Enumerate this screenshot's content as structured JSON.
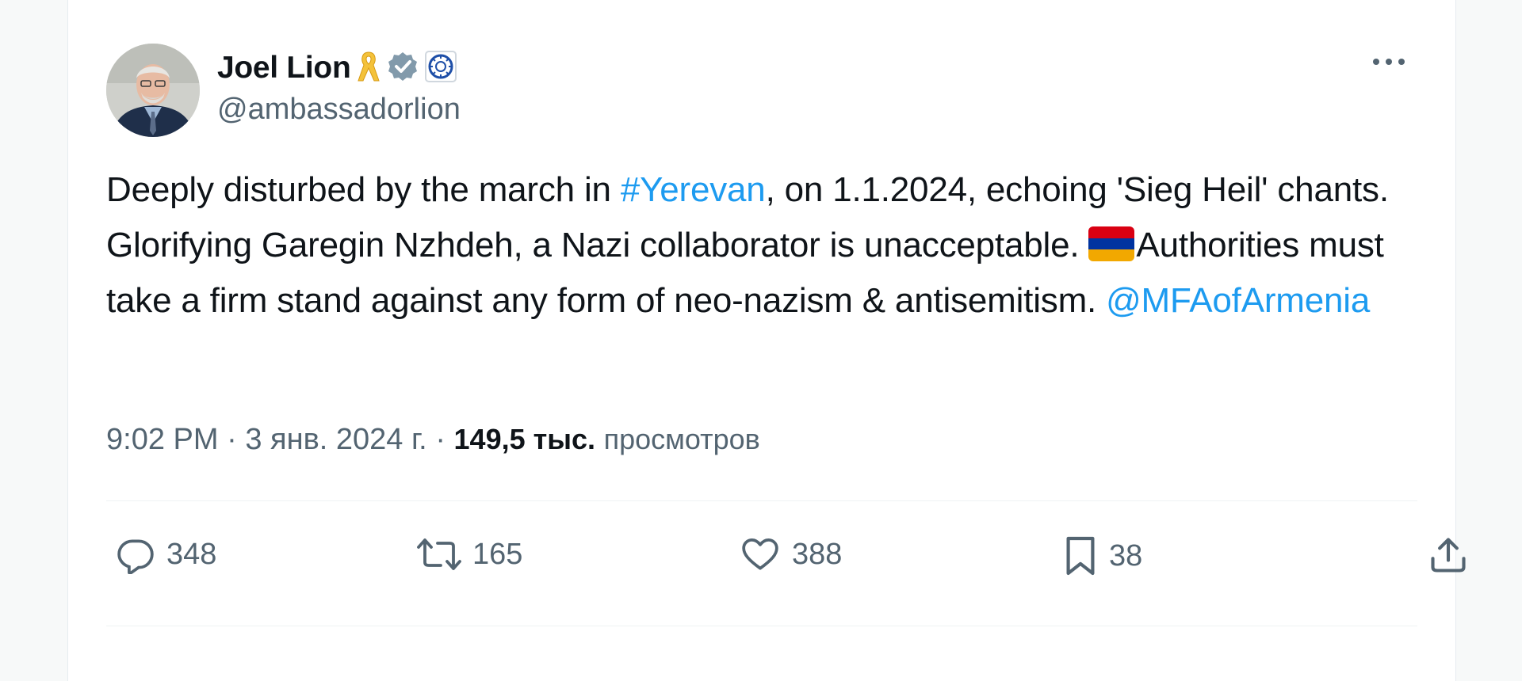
{
  "author": {
    "display_name": "Joel Lion",
    "handle": "@ambassadorlion",
    "badges": [
      "yellow-ribbon-icon",
      "verified-gray-icon",
      "organization-emblem-icon"
    ]
  },
  "tweet": {
    "segments": [
      {
        "text": "Deeply disturbed by the march in ",
        "type": "text"
      },
      {
        "text": "#Yerevan",
        "type": "link"
      },
      {
        "text": ", on 1.1.2024, echoing 'Sieg Heil' chants. Glorifying Garegin Nzhdeh, a Nazi collaborator is unacceptable. ",
        "type": "text"
      },
      {
        "text": "Authorities must take a firm stand against any form of neo-nazism & antisemitism. ",
        "type": "text"
      },
      {
        "text": "@MFAofArmenia",
        "type": "link"
      }
    ],
    "flag_colors": [
      "#d90012",
      "#0033a0",
      "#f2a800"
    ]
  },
  "meta": {
    "time": "9:02 PM",
    "date": "3 янв. 2024 г.",
    "views_count": "149,5 тыс.",
    "views_label": "просмотров"
  },
  "actions": {
    "replies": "348",
    "retweets": "165",
    "likes": "388",
    "bookmarks": "38"
  },
  "colors": {
    "link": "#1d9bf0",
    "secondary_text": "#536471",
    "primary_text": "#0f1419"
  }
}
